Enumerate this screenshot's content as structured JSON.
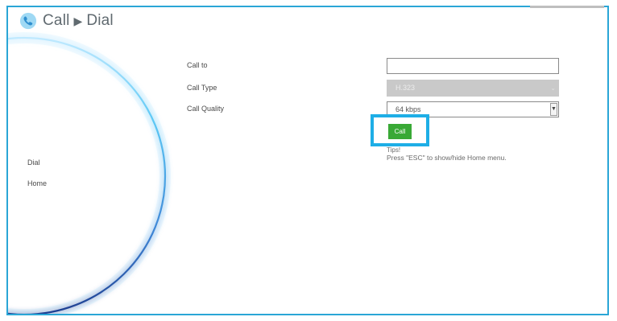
{
  "header": {
    "title_part1": "Call",
    "separator": "▶",
    "title_part2": "Dial",
    "icon": "phone-icon"
  },
  "sidebar": {
    "items": [
      {
        "label": "Dial"
      },
      {
        "label": "Home"
      }
    ]
  },
  "form": {
    "call_to": {
      "label": "Call to",
      "value": ""
    },
    "call_type": {
      "label": "Call Type",
      "selected": "H.323",
      "disabled": true
    },
    "call_quality": {
      "label": "Call Quality",
      "selected": "64 kbps"
    },
    "call_button": "Call"
  },
  "tips": {
    "title": "Tips!",
    "text": "Press \"ESC\" to show/hide Home menu."
  },
  "colors": {
    "frame_border": "#2aa6d6",
    "highlight": "#1eaee6",
    "call_button": "#39a936",
    "disabled_select": "#c9c9c9"
  }
}
